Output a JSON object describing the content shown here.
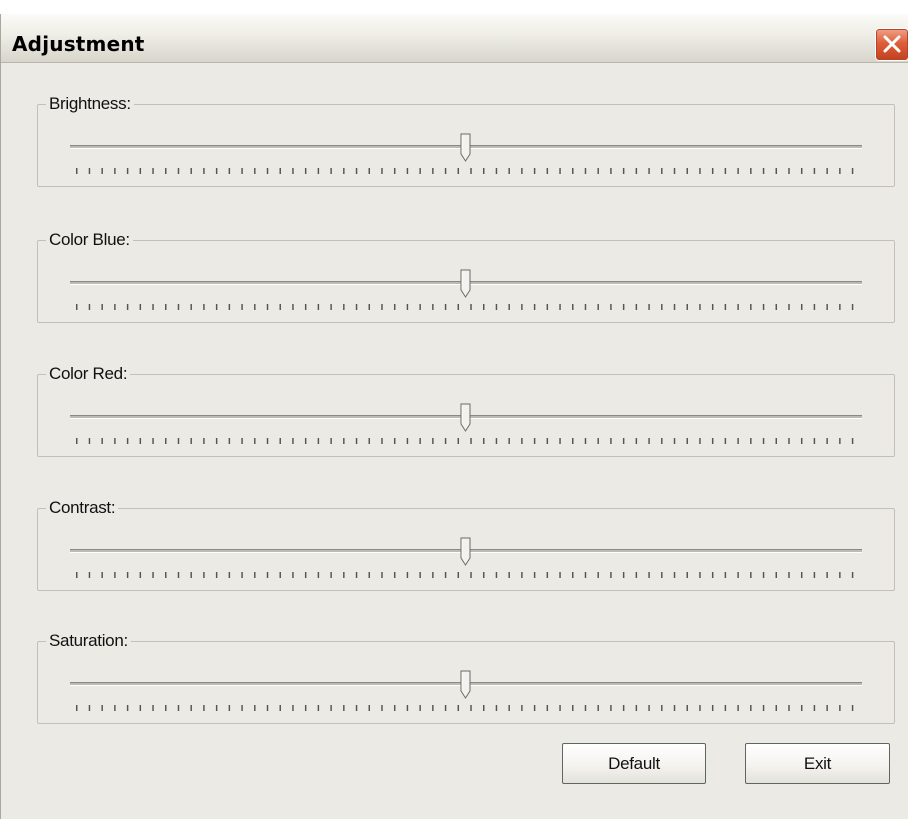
{
  "window": {
    "title": "Adjustment",
    "close_icon": "close-icon"
  },
  "sliders": [
    {
      "label": "Brightness:",
      "value_fraction": 0.5
    },
    {
      "label": "Color Blue:",
      "value_fraction": 0.5
    },
    {
      "label": "Color Red:",
      "value_fraction": 0.5
    },
    {
      "label": "Contrast:",
      "value_fraction": 0.5
    },
    {
      "label": "Saturation:",
      "value_fraction": 0.5
    }
  ],
  "buttons": {
    "default_label": "Default",
    "exit_label": "Exit"
  },
  "colors": {
    "close_button": "#d9532f",
    "dialog_background": "#ebeae4"
  }
}
